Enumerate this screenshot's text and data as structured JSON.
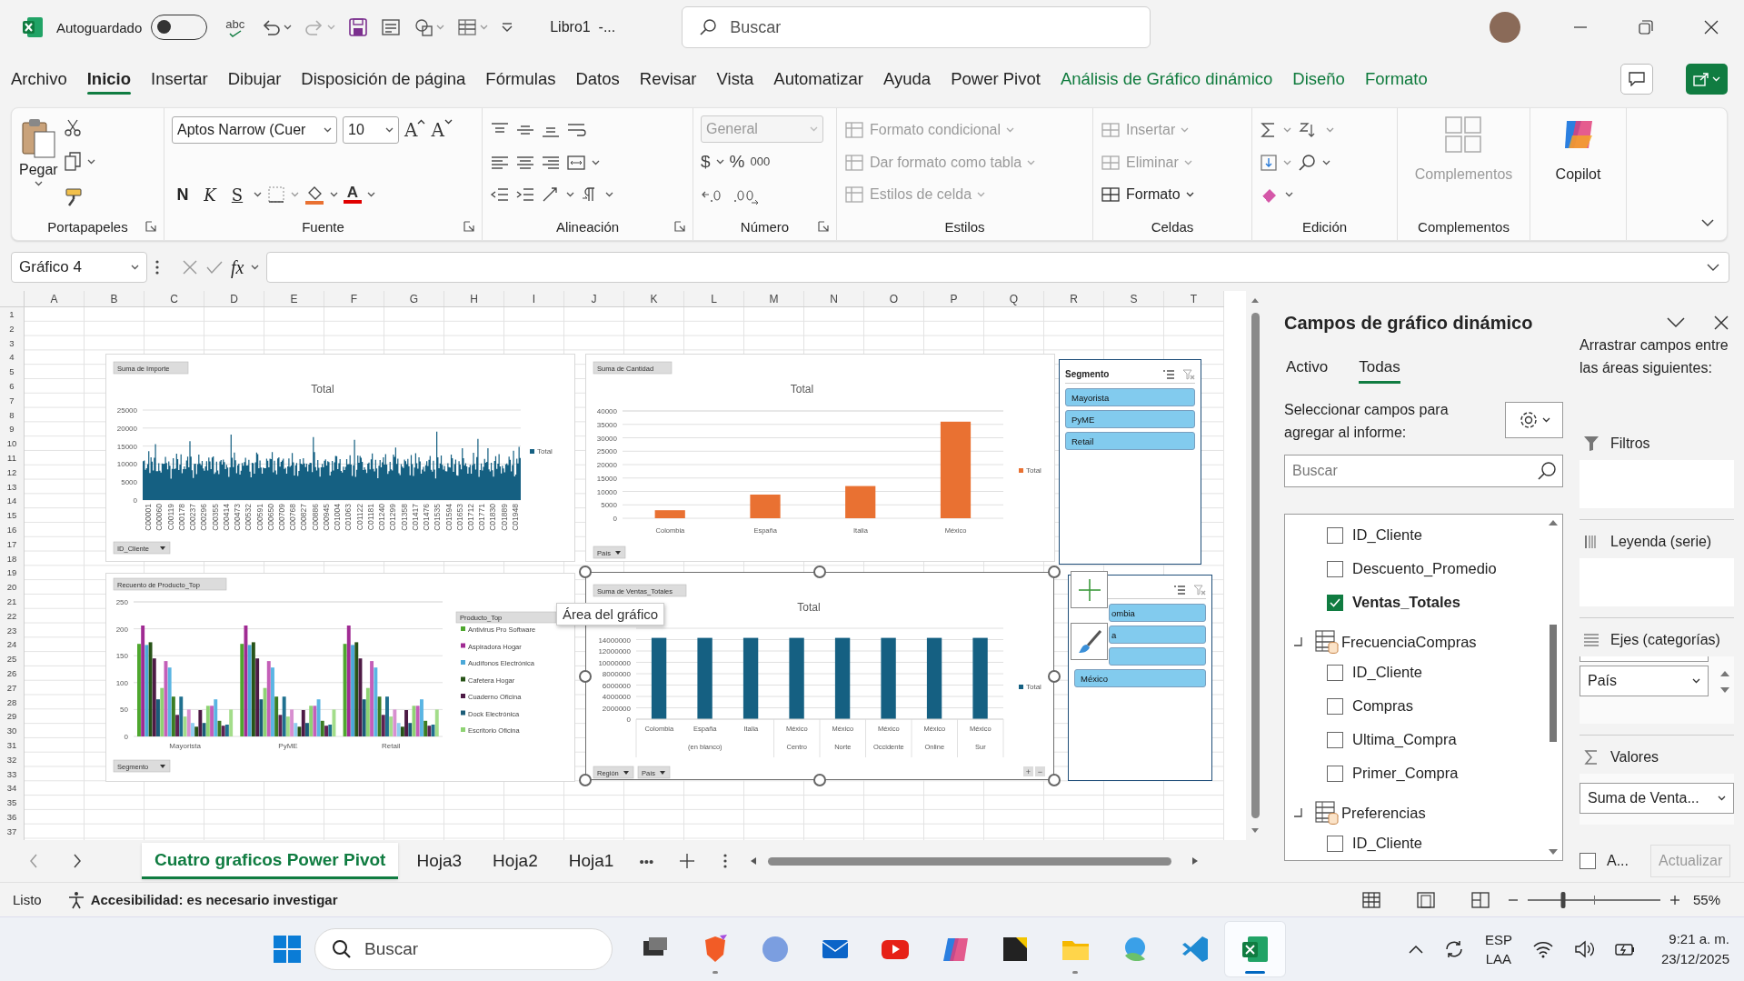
{
  "titlebar": {
    "autosave_label": "Autoguardado",
    "autosave_on": false,
    "spell_label": "abc",
    "doc_title": "Libro1  -...",
    "search_placeholder": "Buscar"
  },
  "menu": {
    "tabs": [
      {
        "label": "Archivo",
        "kind": "standard",
        "selected": false
      },
      {
        "label": "Inicio",
        "kind": "standard",
        "selected": true
      },
      {
        "label": "Insertar",
        "kind": "standard",
        "selected": false
      },
      {
        "label": "Dibujar",
        "kind": "standard",
        "selected": false
      },
      {
        "label": "Disposición de página",
        "kind": "standard",
        "selected": false
      },
      {
        "label": "Fórmulas",
        "kind": "standard",
        "selected": false
      },
      {
        "label": "Datos",
        "kind": "standard",
        "selected": false
      },
      {
        "label": "Revisar",
        "kind": "standard",
        "selected": false
      },
      {
        "label": "Vista",
        "kind": "standard",
        "selected": false
      },
      {
        "label": "Automatizar",
        "kind": "standard",
        "selected": false
      },
      {
        "label": "Ayuda",
        "kind": "standard",
        "selected": false
      },
      {
        "label": "Power Pivot",
        "kind": "standard",
        "selected": false
      },
      {
        "label": "Análisis de Gráfico dinámico",
        "kind": "contextual",
        "selected": false
      },
      {
        "label": "Diseño",
        "kind": "contextual",
        "selected": false
      },
      {
        "label": "Formato",
        "kind": "contextual",
        "selected": false
      }
    ]
  },
  "ribbon": {
    "groups": [
      {
        "kind": "clipboard",
        "label": "Portapapeles",
        "paste": "Pegar"
      },
      {
        "kind": "font",
        "label": "Fuente",
        "font_name": "Aptos Narrow (Cuer",
        "font_size": "10",
        "grow": "A",
        "shrink": "A",
        "styles": [
          "N",
          "K",
          "S"
        ],
        "font_color_letter": "A"
      },
      {
        "kind": "alignment",
        "label": "Alineación"
      },
      {
        "kind": "number",
        "label": "Número",
        "format": "General",
        "format_disabled": true,
        "symbols": [
          "$",
          "%",
          "000"
        ]
      },
      {
        "kind": "styles",
        "label": "Estilos",
        "items": [
          {
            "label": "Formato condicional",
            "disabled": true
          },
          {
            "label": "Dar formato como tabla",
            "disabled": true
          },
          {
            "label": "Estilos de celda",
            "disabled": true
          }
        ]
      },
      {
        "kind": "cells",
        "label": "Celdas",
        "items": [
          {
            "label": "Insertar",
            "disabled": true
          },
          {
            "label": "Eliminar",
            "disabled": true
          },
          {
            "label": "Formato",
            "disabled": false
          }
        ]
      },
      {
        "kind": "editing",
        "label": "Edición"
      },
      {
        "kind": "addins",
        "label": "Complementos",
        "button": "Complementos",
        "disabled": true
      },
      {
        "kind": "copilot",
        "button": "Copilot"
      }
    ]
  },
  "formula_bar": {
    "name_box": "Gráfico 4",
    "fx": "fx"
  },
  "sheet": {
    "columns": [
      "A",
      "B",
      "C",
      "D",
      "E",
      "F",
      "G",
      "H",
      "I",
      "J",
      "K",
      "L",
      "M",
      "N",
      "O",
      "P",
      "Q",
      "R",
      "S",
      "T"
    ],
    "rows": [
      "1",
      "2",
      "3",
      "4",
      "5",
      "6",
      "7",
      "8",
      "9",
      "10",
      "11",
      "12",
      "13",
      "14",
      "15",
      "16",
      "17",
      "18",
      "19",
      "20",
      "21",
      "22",
      "23",
      "24",
      "25",
      "26",
      "27",
      "28",
      "29",
      "30",
      "31",
      "32",
      "33",
      "34",
      "35",
      "36",
      "37"
    ]
  },
  "charts": [
    {
      "kind": "dense_bars",
      "selected": false,
      "field_button": "Suma de Importe",
      "title": "Total",
      "y_labels": [
        "25000",
        "20000",
        "15000",
        "10000",
        "5000",
        "0"
      ],
      "x_labels": [
        "C00001",
        "C00060",
        "C00119",
        "C00178",
        "C00237",
        "C00296",
        "C00355",
        "C00414",
        "C00473",
        "C00532",
        "C00591",
        "C00650",
        "C00709",
        "C00768",
        "C00827",
        "C00886",
        "C00945",
        "C01004",
        "C01063",
        "C01122",
        "C01181",
        "C01240",
        "C01299",
        "C01358",
        "C01417",
        "C01476",
        "C01535",
        "C01594",
        "C01653",
        "C01712",
        "C01771",
        "C01830",
        "C01889",
        "C01948"
      ],
      "legend": "Total",
      "axis_buttons": [
        "ID_Cliente"
      ]
    },
    {
      "kind": "bar",
      "selected": false,
      "field_button": "Suma de Cantidad",
      "axis_buttons": [
        "País"
      ],
      "chart_data": {
        "type": "bar",
        "title": "Total",
        "categories": [
          "Colombia",
          "España",
          "Italia",
          "México"
        ],
        "series": [
          {
            "name": "Total",
            "color": "#e97132",
            "values": [
              3000,
              8800,
              12000,
              36000
            ]
          }
        ],
        "grid": true,
        "legend": "right",
        "ylim": [
          0,
          40000
        ],
        "yticks": [
          0,
          5000,
          10000,
          15000,
          20000,
          25000,
          30000,
          35000,
          40000
        ]
      }
    },
    {
      "kind": "bar",
      "selected": false,
      "field_button": "Recuento de Producto_Top",
      "legend_button": "Producto_Top",
      "axis_buttons": [
        "Segmento"
      ],
      "chart_data": {
        "type": "bar",
        "categories": [
          "Mayorista",
          "PyME",
          "Retail"
        ],
        "series": [
          {
            "name": "Antivirus Pro Software",
            "color": "#4ea72e",
            "values": [
              172,
              172,
              172
            ]
          },
          {
            "name": "Aspiradora Hogar",
            "color": "#a02b93",
            "values": [
              206,
              206,
              206
            ]
          },
          {
            "name": "Audífonos Electrónica",
            "color": "#4ba8d8",
            "values": [
              170,
              170,
              170
            ]
          },
          {
            "name": "Cafetera Hogar",
            "color": "#275317",
            "values": [
              175,
              175,
              175
            ]
          },
          {
            "name": "Cuaderno Oficina",
            "color": "#4d1a45",
            "values": [
              145,
              145,
              145
            ]
          },
          {
            "name": "Dock Electrónica",
            "color": "#1b5c78",
            "values": [
              69,
              69,
              69
            ]
          },
          {
            "name": "Escritorio Oficina",
            "color": "#8ed373",
            "values": [
              90,
              90,
              90
            ]
          },
          {
            "color": "#c45fb8",
            "values": [
              140,
              140,
              140
            ]
          },
          {
            "color": "#5ab5e3",
            "values": [
              128,
              128,
              128
            ]
          },
          {
            "color": "#3b7d23",
            "values": [
              74,
              74,
              74
            ]
          },
          {
            "color": "#5e2253",
            "values": [
              40,
              40,
              40
            ]
          },
          {
            "color": "#20708f",
            "values": [
              74,
              74,
              74
            ]
          },
          {
            "color": "#a3dd8a",
            "values": [
              37,
              37,
              37
            ]
          },
          {
            "color": "#d88fd0",
            "values": [
              50,
              50,
              50
            ]
          },
          {
            "color": "#8fcdef",
            "values": [
              25,
              25,
              25
            ]
          },
          {
            "color": "#275317",
            "values": [
              18,
              18,
              18
            ]
          },
          {
            "color": "#4d1a45",
            "values": [
              49,
              49,
              49
            ]
          },
          {
            "color": "#1b5c78",
            "values": [
              25,
              25,
              25
            ]
          },
          {
            "color": "#8ed373",
            "values": [
              57,
              57,
              57
            ]
          },
          {
            "color": "#c45fb8",
            "values": [
              57,
              57,
              57
            ]
          },
          {
            "color": "#5ab5e3",
            "values": [
              69,
              69,
              69
            ]
          },
          {
            "color": "#3b7d23",
            "values": [
              29,
              29,
              29
            ]
          },
          {
            "color": "#5e2253",
            "values": [
              20,
              20,
              20
            ]
          },
          {
            "color": "#20708f",
            "values": [
              22,
              22,
              22
            ]
          },
          {
            "color": "#a3dd8a",
            "values": [
              50,
              50,
              50
            ]
          }
        ],
        "grid": true,
        "legend": "right",
        "ylim": [
          0,
          250
        ],
        "yticks": [
          0,
          50,
          100,
          150,
          200,
          250
        ]
      }
    },
    {
      "kind": "bar",
      "selected": true,
      "field_button": "Suma de Ventas_Totales",
      "axis_buttons": [
        "Región",
        "País"
      ],
      "expand_buttons": [
        "+",
        "−"
      ],
      "chart_data": {
        "type": "bar",
        "title": "Total",
        "categories": [
          "Colombia",
          "España",
          "Italia",
          "México",
          "México",
          "México",
          "México",
          "México"
        ],
        "annotations": [
          "(en blanco)",
          "Centro",
          "Norte",
          "Occidente",
          "Online",
          "Sur"
        ],
        "grid": true,
        "legend": "right",
        "series": [
          {
            "name": "Total",
            "color": "#156082",
            "values": [
              14300000,
              14300000,
              14300000,
              14300000,
              14300000,
              14300000,
              14300000,
              14300000
            ]
          }
        ],
        "ylim": [
          0,
          16000000
        ],
        "yticks": [
          0,
          2000000,
          4000000,
          6000000,
          8000000,
          10000000,
          12000000,
          14000000
        ]
      }
    }
  ],
  "slicers": [
    {
      "title": "Segmento",
      "items": [
        {
          "label": "Mayorista",
          "selected": true
        },
        {
          "label": "PyME",
          "selected": true
        },
        {
          "label": "Retail",
          "selected": true
        }
      ]
    },
    {
      "items": [
        {
          "label": "ombia",
          "selected": true
        },
        {
          "label": "a",
          "selected": true
        },
        {
          "selected": true
        },
        {
          "label": "México",
          "selected": true
        }
      ]
    }
  ],
  "tooltip": "Área del gráfico",
  "sheet_tabs": {
    "tabs": [
      {
        "label": "Cuatro graficos Power Pivot",
        "selected": true
      },
      {
        "label": "Hoja3",
        "selected": false
      },
      {
        "label": "Hoja2",
        "selected": false
      },
      {
        "label": "Hoja1",
        "selected": false
      }
    ],
    "more": "•••"
  },
  "field_pane": {
    "title": "Campos de gráfico dinámico",
    "tabs": [
      {
        "label": "Activo",
        "selected": false
      },
      {
        "label": "Todas",
        "selected": true
      }
    ],
    "instruction": "Seleccionar campos para agregar al informe:",
    "search_placeholder": "Buscar",
    "tables": [
      {
        "children": [
          {
            "label": "ID_Cliente",
            "checked": false
          },
          {
            "label": "Descuento_Promedio",
            "checked": false
          },
          {
            "label": "Ventas_Totales",
            "checked": true
          }
        ]
      },
      {
        "label": "FrecuenciaCompras",
        "expanded": true,
        "children": [
          {
            "label": "ID_Cliente",
            "checked": false
          },
          {
            "label": "Compras",
            "checked": false
          },
          {
            "label": "Ultima_Compra",
            "checked": false
          },
          {
            "label": "Primer_Compra",
            "checked": false
          }
        ]
      },
      {
        "label": "Preferencias",
        "expanded": true,
        "children": [
          {
            "label": "ID_Cliente",
            "checked": false
          }
        ]
      }
    ],
    "areas_hint": "Arrastrar campos entre las áreas siguientes:",
    "areas": [
      {
        "kind": "filters",
        "label": "Filtros"
      },
      {
        "kind": "legend",
        "label": "Leyenda (serie)"
      },
      {
        "kind": "axis",
        "label": "Ejes (categorías)",
        "fields": [
          "País"
        ]
      },
      {
        "kind": "values",
        "label": "Valores",
        "fields": [
          "Suma de Venta..."
        ]
      }
    ],
    "defer_label": "A...",
    "defer_checked": false,
    "update_button": "Actualizar",
    "update_disabled": true
  },
  "status_bar": {
    "ready": "Listo",
    "accessibility": "Accesibilidad: es necesario investigar",
    "zoom": {
      "level": 0.27,
      "reading": "55%"
    }
  },
  "taskbar": {
    "search_placeholder": "Buscar",
    "apps": [
      {
        "kind": "taskview",
        "running": false,
        "active": false
      },
      {
        "kind": "browser",
        "running": true,
        "active": false
      },
      {
        "kind": "circle",
        "running": false,
        "active": false
      },
      {
        "kind": "mail",
        "running": false,
        "active": false
      },
      {
        "kind": "video",
        "running": false,
        "active": false
      },
      {
        "kind": "copilot",
        "running": false,
        "active": false
      },
      {
        "kind": "notes",
        "running": false,
        "active": false
      },
      {
        "kind": "folder",
        "running": true,
        "active": false
      },
      {
        "kind": "weather",
        "running": false,
        "active": false
      },
      {
        "kind": "code",
        "running": false,
        "active": false
      },
      {
        "kind": "sheet",
        "running": true,
        "active": true
      }
    ],
    "language": "ESP",
    "region": "LAA",
    "time": "9:21 a. m.",
    "date": "23/12/2025"
  }
}
